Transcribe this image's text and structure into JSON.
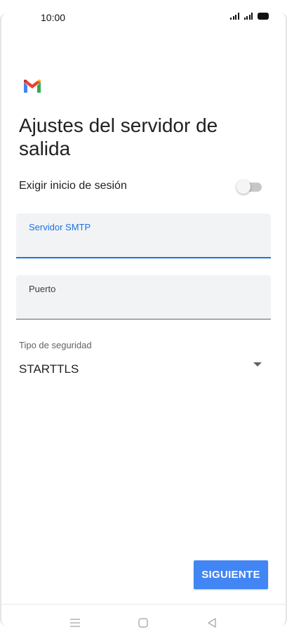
{
  "status_bar": {
    "time": "10:00"
  },
  "app": {
    "logo_icon": "gmail-icon",
    "colors": {
      "accent": "#1a73e8",
      "button": "#4285f4",
      "field_bg": "#f1f3f4"
    }
  },
  "page": {
    "title": "Ajustes del servidor de salida"
  },
  "require_login": {
    "label": "Exigir inicio de sesión",
    "enabled": false
  },
  "smtp_field": {
    "label": "Servidor SMTP",
    "value": ""
  },
  "port_field": {
    "label": "Puerto",
    "value": ""
  },
  "security": {
    "label": "Tipo de seguridad",
    "selected": "STARTTLS"
  },
  "actions": {
    "next_label": "SIGUIENTE"
  },
  "nav_bar": {
    "icons": [
      "menu-icon",
      "home-icon",
      "back-icon"
    ]
  }
}
